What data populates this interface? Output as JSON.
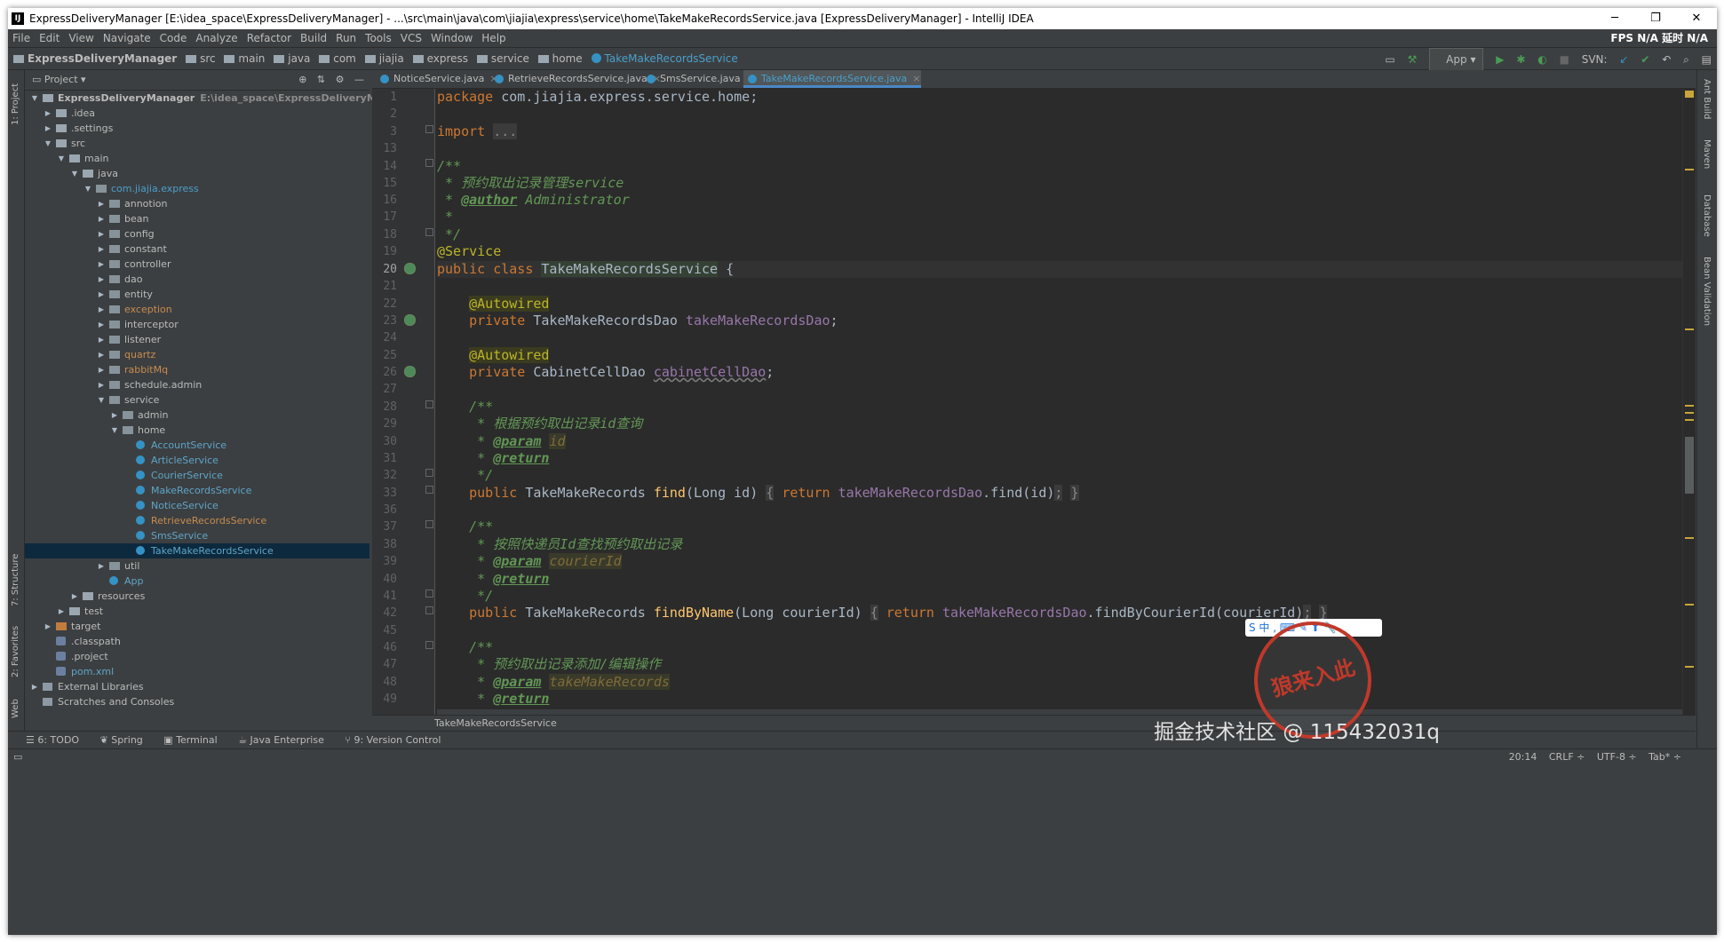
{
  "window": {
    "title": "ExpressDeliveryManager [E:\\idea_space\\ExpressDeliveryManager] - ...\\src\\main\\java\\com\\jiajia\\express\\service\\home\\TakeMakeRecordsService.java [ExpressDeliveryManager] - IntelliJ IDEA",
    "logo": "IJ",
    "minimize": "─",
    "maximize": "❐",
    "close": "✕"
  },
  "menu": {
    "items": [
      "File",
      "Edit",
      "View",
      "Navigate",
      "Code",
      "Analyze",
      "Refactor",
      "Build",
      "Run",
      "Tools",
      "VCS",
      "Window",
      "Help"
    ],
    "right": "FPS N/A 延时 N/A"
  },
  "nav": {
    "crumbs": [
      "ExpressDeliveryManager",
      "src",
      "main",
      "java",
      "com",
      "jiajia",
      "express",
      "service",
      "home",
      "TakeMakeRecordsService"
    ],
    "run_config": "App",
    "svn_label": "SVN:"
  },
  "project": {
    "header": "Project",
    "tree": [
      {
        "label": "ExpressDeliveryManager",
        "sub": "E:\\idea_space\\ExpressDeliveryManager",
        "depth": 0,
        "arrow": "▼",
        "icon": "folder",
        "color": "bold"
      },
      {
        "label": ".idea",
        "depth": 1,
        "arrow": "▶",
        "icon": "folder"
      },
      {
        "label": ".settings",
        "depth": 1,
        "arrow": "▶",
        "icon": "folder"
      },
      {
        "label": "src",
        "depth": 1,
        "arrow": "▼",
        "icon": "folder"
      },
      {
        "label": "main",
        "depth": 2,
        "arrow": "▼",
        "icon": "folder"
      },
      {
        "label": "java",
        "depth": 3,
        "arrow": "▼",
        "icon": "folder"
      },
      {
        "label": "com.jiajia.express",
        "depth": 4,
        "arrow": "▼",
        "icon": "pkg",
        "color": "blue"
      },
      {
        "label": "annotion",
        "depth": 5,
        "arrow": "▶",
        "icon": "pkg"
      },
      {
        "label": "bean",
        "depth": 5,
        "arrow": "▶",
        "icon": "pkg"
      },
      {
        "label": "config",
        "depth": 5,
        "arrow": "▶",
        "icon": "pkg"
      },
      {
        "label": "constant",
        "depth": 5,
        "arrow": "▶",
        "icon": "pkg"
      },
      {
        "label": "controller",
        "depth": 5,
        "arrow": "▶",
        "icon": "pkg"
      },
      {
        "label": "dao",
        "depth": 5,
        "arrow": "▶",
        "icon": "pkg"
      },
      {
        "label": "entity",
        "depth": 5,
        "arrow": "▶",
        "icon": "pkg"
      },
      {
        "label": "exception",
        "depth": 5,
        "arrow": "▶",
        "icon": "pkg",
        "color": "orange"
      },
      {
        "label": "interceptor",
        "depth": 5,
        "arrow": "▶",
        "icon": "pkg"
      },
      {
        "label": "listener",
        "depth": 5,
        "arrow": "▶",
        "icon": "pkg"
      },
      {
        "label": "quartz",
        "depth": 5,
        "arrow": "▶",
        "icon": "pkg",
        "color": "orange"
      },
      {
        "label": "rabbitMq",
        "depth": 5,
        "arrow": "▶",
        "icon": "pkg",
        "color": "orange"
      },
      {
        "label": "schedule.admin",
        "depth": 5,
        "arrow": "▶",
        "icon": "pkg"
      },
      {
        "label": "service",
        "depth": 5,
        "arrow": "▼",
        "icon": "pkg"
      },
      {
        "label": "admin",
        "depth": 6,
        "arrow": "▶",
        "icon": "pkg"
      },
      {
        "label": "home",
        "depth": 6,
        "arrow": "▼",
        "icon": "pkg"
      },
      {
        "label": "AccountService",
        "depth": 7,
        "arrow": "",
        "icon": "cls",
        "color": "cyan"
      },
      {
        "label": "ArticleService",
        "depth": 7,
        "arrow": "",
        "icon": "cls",
        "color": "cyan"
      },
      {
        "label": "CourierService",
        "depth": 7,
        "arrow": "",
        "icon": "cls",
        "color": "cyan"
      },
      {
        "label": "MakeRecordsService",
        "depth": 7,
        "arrow": "",
        "icon": "cls",
        "color": "cyan"
      },
      {
        "label": "NoticeService",
        "depth": 7,
        "arrow": "",
        "icon": "cls",
        "color": "cyan"
      },
      {
        "label": "RetrieveRecordsService",
        "depth": 7,
        "arrow": "",
        "icon": "cls",
        "color": "orange"
      },
      {
        "label": "SmsService",
        "depth": 7,
        "arrow": "",
        "icon": "cls",
        "color": "cyan"
      },
      {
        "label": "TakeMakeRecordsService",
        "depth": 7,
        "arrow": "",
        "icon": "cls",
        "color": "cyan",
        "selected": true
      },
      {
        "label": "util",
        "depth": 5,
        "arrow": "▶",
        "icon": "pkg"
      },
      {
        "label": "App",
        "depth": 5,
        "arrow": "",
        "icon": "cls",
        "color": "cyan"
      },
      {
        "label": "resources",
        "depth": 3,
        "arrow": "▶",
        "icon": "folder"
      },
      {
        "label": "test",
        "depth": 2,
        "arrow": "▶",
        "icon": "folder"
      },
      {
        "label": "target",
        "depth": 1,
        "arrow": "▶",
        "icon": "tgt"
      },
      {
        "label": ".classpath",
        "depth": 1,
        "arrow": "",
        "icon": "file"
      },
      {
        "label": ".project",
        "depth": 1,
        "arrow": "",
        "icon": "file"
      },
      {
        "label": "pom.xml",
        "depth": 1,
        "arrow": "",
        "icon": "file",
        "color": "cyan"
      },
      {
        "label": "External Libraries",
        "depth": 0,
        "arrow": "▶",
        "icon": "lib"
      },
      {
        "label": "Scratches and Consoles",
        "depth": 0,
        "arrow": "",
        "icon": "lib"
      }
    ]
  },
  "left_strip": [
    "1: Project",
    "7: Structure",
    "2: Favorites",
    "Web"
  ],
  "right_strip": [
    "Ant Build",
    "Maven",
    "Database",
    "Bean Validation"
  ],
  "tabs": [
    {
      "label": "NoticeService.java"
    },
    {
      "label": "RetrieveRecordsService.java"
    },
    {
      "label": "SmsService.java"
    },
    {
      "label": "TakeMakeRecordsService.java",
      "active": true
    }
  ],
  "editor": {
    "line_numbers": [
      "1",
      "2",
      "3",
      "13",
      "14",
      "15",
      "16",
      "17",
      "18",
      "19",
      "20",
      "21",
      "22",
      "23",
      "24",
      "25",
      "26",
      "27",
      "28",
      "29",
      "30",
      "31",
      "32",
      "33",
      "36",
      "37",
      "38",
      "39",
      "40",
      "41",
      "42",
      "45",
      "46",
      "47",
      "48",
      "49"
    ],
    "current_line": "20",
    "breadcrumb": "TakeMakeRecordsService"
  },
  "bottom_tabs": [
    "6: TODO",
    "Spring",
    "Terminal",
    "Java Enterprise",
    "9: Version Control"
  ],
  "status": {
    "position": "20:14",
    "line_sep": "CRLF ÷",
    "encoding": "UTF-8 ÷",
    "indent": "Tab* ÷"
  },
  "overlay": {
    "watermark": "掘金技术社区 @ 115432031q",
    "ime": "S 中 ,",
    "stamp": "狼来入此"
  }
}
